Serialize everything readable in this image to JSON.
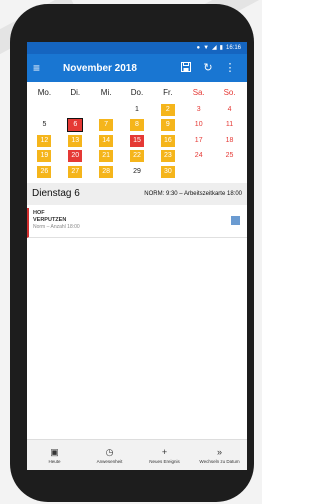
{
  "status_bar": {
    "time": "16:16"
  },
  "app_bar": {
    "title": "November 2018",
    "menu_icon": "hamburger-menu-icon",
    "save_icon": "save-icon",
    "refresh_icon": "refresh-icon",
    "more_icon": "more-vert-icon"
  },
  "colors": {
    "app_bar": "#1976d2",
    "status_bar": "#1565c0",
    "event_day": "#f5b51b",
    "selected_day": "#e53935",
    "weekend_text": "#e53935",
    "event_square": "#6b9bd1"
  },
  "calendar": {
    "weekdays": [
      "Mo.",
      "Di.",
      "Mi.",
      "Do.",
      "Fr.",
      "Sa.",
      "So."
    ],
    "days": [
      {
        "label": "",
        "style": "plain"
      },
      {
        "label": "",
        "style": "plain"
      },
      {
        "label": "",
        "style": "plain"
      },
      {
        "label": "1",
        "style": "plain"
      },
      {
        "label": "2",
        "style": "ev"
      },
      {
        "label": "3",
        "style": "we"
      },
      {
        "label": "4",
        "style": "we"
      },
      {
        "label": "5",
        "style": "plain"
      },
      {
        "label": "6",
        "style": "red today"
      },
      {
        "label": "7",
        "style": "ev"
      },
      {
        "label": "8",
        "style": "ev"
      },
      {
        "label": "9",
        "style": "ev"
      },
      {
        "label": "10",
        "style": "we"
      },
      {
        "label": "11",
        "style": "we"
      },
      {
        "label": "12",
        "style": "ev"
      },
      {
        "label": "13",
        "style": "ev"
      },
      {
        "label": "14",
        "style": "ev"
      },
      {
        "label": "15",
        "style": "red"
      },
      {
        "label": "16",
        "style": "ev"
      },
      {
        "label": "17",
        "style": "we"
      },
      {
        "label": "18",
        "style": "we"
      },
      {
        "label": "19",
        "style": "ev"
      },
      {
        "label": "20",
        "style": "red"
      },
      {
        "label": "21",
        "style": "ev"
      },
      {
        "label": "22",
        "style": "ev"
      },
      {
        "label": "23",
        "style": "ev"
      },
      {
        "label": "24",
        "style": "we"
      },
      {
        "label": "25",
        "style": "we"
      },
      {
        "label": "26",
        "style": "ev"
      },
      {
        "label": "27",
        "style": "ev"
      },
      {
        "label": "28",
        "style": "ev"
      },
      {
        "label": "29",
        "style": "plain"
      },
      {
        "label": "30",
        "style": "ev"
      },
      {
        "label": "",
        "style": "plain"
      },
      {
        "label": "",
        "style": "plain"
      }
    ]
  },
  "selected_day": {
    "title": "Dienstag 6",
    "info": "NORM: 9:30 – Arbeitszeitkarte 18:00"
  },
  "event": {
    "line1": "HOF",
    "line2": "VERPUTZEN",
    "line3": "Norm – Anzahl 18:00"
  },
  "bottom_nav": [
    {
      "label": "Heute",
      "icon": "calendar-today-icon",
      "glyph": "▣"
    },
    {
      "label": "Anwesenheit",
      "icon": "clock-icon",
      "glyph": "◷"
    },
    {
      "label": "Neues Ereignis",
      "icon": "plus-icon",
      "glyph": "+"
    },
    {
      "label": "Wechseln zu Datum",
      "icon": "double-chevron-right-icon",
      "glyph": "»"
    }
  ]
}
